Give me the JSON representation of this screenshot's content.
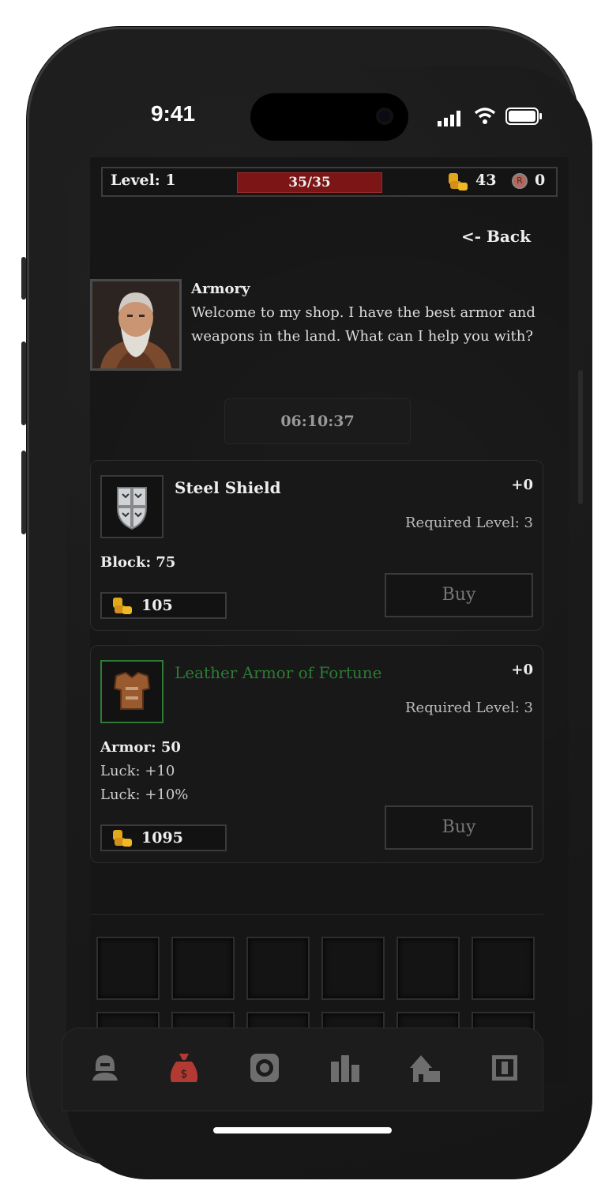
{
  "status_bar": {
    "time": "9:41"
  },
  "hud": {
    "level_label": "Level: 1",
    "hp_text": "35/35",
    "gold": "43",
    "rune_currency": "0"
  },
  "back_label": "<- Back",
  "merchant": {
    "title": "Armory",
    "message": "Welcome to my shop. I have the best armor and weapons in the land. What can I help you with?"
  },
  "restock_timer": "06:10:37",
  "items": [
    {
      "name": "Steel Shield",
      "upgrade": "+0",
      "required_level": "Required Level: 3",
      "stats": [
        "Block: 75"
      ],
      "price": "105",
      "buy_label": "Buy",
      "icon": "shield-icon"
    },
    {
      "name": "Leather Armor of Fortune",
      "upgrade": "+0",
      "required_level": "Required Level: 3",
      "stats": [
        "Armor: 50",
        "Luck: +10",
        "Luck: +10%"
      ],
      "price": "1095",
      "buy_label": "Buy",
      "icon": "leather-armor-icon",
      "name_color": "#2e7a36"
    }
  ],
  "inventory": {
    "rows": 2,
    "cols": 6
  },
  "nav": [
    "character-icon",
    "shop-bag-icon",
    "vault-icon",
    "leaderboard-icon",
    "town-icon",
    "quest-icon"
  ],
  "colors": {
    "accent_active": "#b23a32",
    "hp_bar": "#7c1515",
    "nav_inactive": "#6e6e6e"
  }
}
